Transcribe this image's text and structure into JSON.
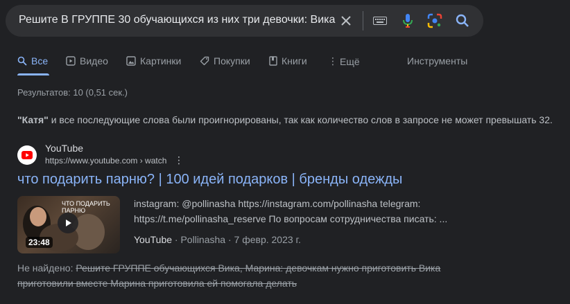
{
  "search": {
    "query": "Решите В ГРУППЕ 30 обучающихся из них три девочки: Вика",
    "clear_icon": "close-icon",
    "keyboard_icon": "keyboard-icon",
    "mic_icon": "mic-icon",
    "lens_icon": "lens-icon",
    "search_icon": "search-icon"
  },
  "tabs": [
    {
      "label": "Все",
      "icon": "search-icon",
      "active": true
    },
    {
      "label": "Видео",
      "icon": "play-icon"
    },
    {
      "label": "Картинки",
      "icon": "image-icon"
    },
    {
      "label": "Покупки",
      "icon": "tag-icon"
    },
    {
      "label": "Книги",
      "icon": "book-icon"
    },
    {
      "label": "Ещё",
      "icon": "more-icon"
    }
  ],
  "tools_label": "Инструменты",
  "stats": "Результатов: 10 (0,51 сек.)",
  "notice": {
    "word": "\"Катя\"",
    "text": " и все последующие слова были проигнорированы, так как количество слов в запросе не может превышать 32."
  },
  "result": {
    "site_name": "YouTube",
    "url": "https://www.youtube.com › watch",
    "title": "что подарить парню? | 100 идей подарков | бренды одежды",
    "thumbnail_text": "ЧТО ПОДАРИТЬ ПАРНЮ",
    "duration": "23:48",
    "snippet": "instagram: @pollinasha https://instagram.com/pollinasha telegram: https://t.me/pollinasha_reserve По вопросам сотрудничества писать: ...",
    "meta_source": "YouTube",
    "meta_author": "Pollinasha",
    "meta_date": "7 февр. 2023 г.",
    "sep": " · "
  },
  "missing": {
    "label": "Не найдено: ",
    "terms": "Решите ГРУППЕ обучающихся Вика, Марина: девочкам нужно приготовить Вика приготовили вместе Марина приготовила ей помогала делать"
  },
  "colors": {
    "background": "#202124",
    "link": "#8ab4f8",
    "search_bar": "#303134"
  }
}
